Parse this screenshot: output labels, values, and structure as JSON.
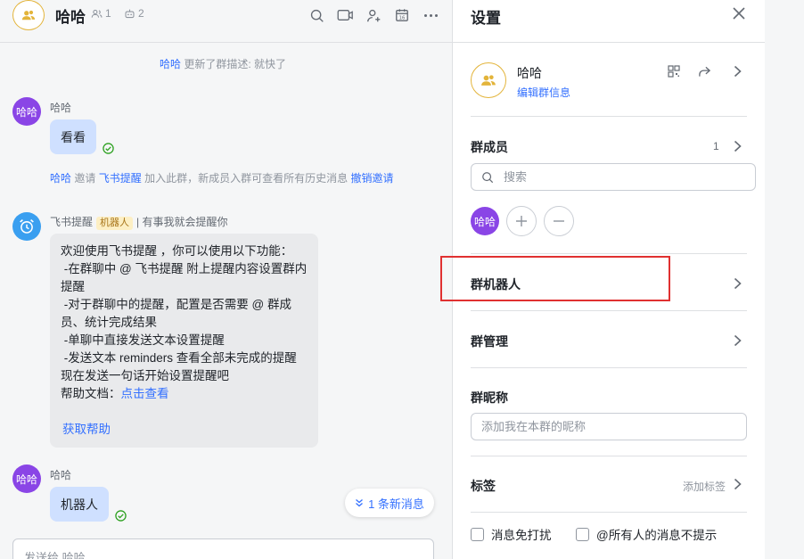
{
  "chat": {
    "header": {
      "title": "哈哈",
      "member_count": "1",
      "bot_count": "2"
    },
    "system_update": {
      "actor": "哈哈",
      "text": "更新了群描述: 就快了"
    },
    "messages": [
      {
        "avatar": "哈哈",
        "sender": "哈哈",
        "text": "看看"
      }
    ],
    "invite_notice": {
      "actor": "哈哈",
      "verb": "邀请",
      "target": "飞书提醒",
      "text": "加入此群，新成员入群可查看所有历史消息",
      "revoke": "撤销邀请"
    },
    "bot_message": {
      "sender": "飞书提醒",
      "tag": "机器人",
      "signature": "| 有事我就会提醒你",
      "lines": [
        "欢迎使用飞书提醒 ，你可以使用以下功能：",
        " -在群聊中 @ 飞书提醒 附上提醒内容设置群内提醒",
        " -对于群聊中的提醒，配置是否需要 @ 群成员、统计完成结果",
        " -单聊中直接发送文本设置提醒",
        " -发送文本 reminders 查看全部未完成的提醒",
        "现在发送一句话开始设置提醒吧"
      ],
      "doc_label": "帮助文档：",
      "doc_link": "点击查看",
      "help_link": "获取帮助"
    },
    "last_message": {
      "avatar": "哈哈",
      "sender": "哈哈",
      "text": "机器人"
    },
    "new_messages_pill": "1 条新消息",
    "composer_placeholder": "发送给 哈哈"
  },
  "settings": {
    "title": "设置",
    "group_name": "哈哈",
    "edit_info": "编辑群信息",
    "members_label": "群成员",
    "members_count": "1",
    "search_placeholder": "搜索",
    "member_avatar": "哈哈",
    "bots_label": "群机器人",
    "manage_label": "群管理",
    "nickname_label": "群昵称",
    "nickname_placeholder": "添加我在本群的昵称",
    "tags_label": "标签",
    "add_tag": "添加标签",
    "mute_label": "消息免打扰",
    "at_all_label": "@所有人的消息不提示"
  },
  "colors": {
    "accent": "#3370ff",
    "avatar_purple": "#8a45e6",
    "highlight": "#e03131",
    "bot_tag_bg": "#fdefc4",
    "bubble": "#cfe0ff"
  }
}
